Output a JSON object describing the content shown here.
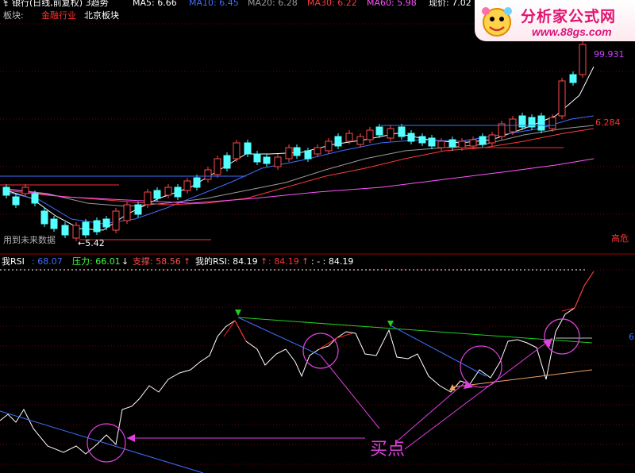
{
  "header": {
    "stock_title": "钅银行(日线,前复权) 3趋势",
    "ma_items": [
      {
        "label": "MA5: 6.66",
        "color": "#ffffff"
      },
      {
        "label": "MA10: 6.45",
        "color": "#3f6fff"
      },
      {
        "label": "MA20: 6.28",
        "color": "#9b9b9b"
      },
      {
        "label": "MA30: 6.22",
        "color": "#ff3b3b"
      },
      {
        "label": "MA60: 5.98",
        "color": "#ff55ff"
      }
    ],
    "current_price": "现价: 7.02",
    "sector_label": "板块:",
    "sectors": [
      {
        "label": "金融行业",
        "color": "#ff3030"
      },
      {
        "label": "北京板块",
        "color": "#ffffff"
      }
    ]
  },
  "logo": {
    "line1": "分析家公式网",
    "line2": "www.88gs.com"
  },
  "price_panel": {
    "high_label": "99.931",
    "mid_label": "6.284",
    "low_label": "←5.42",
    "bottom_left_note": "用到未来数据",
    "right_note": "高危"
  },
  "rsi_header": {
    "name": "我RSI",
    "name_value": ": 68.07",
    "pressure_label": "压力: 66.01",
    "pressure_arrow": "↓",
    "support_label": "支撑: 58.56",
    "support_arrow": "↑",
    "myrsi_label": "我的RSI: 84.19",
    "myrsi_arrow": "↑",
    "val2": ": 84.19",
    "val2_arrow": "↑",
    "val3": ": - : 84.19"
  },
  "rsi_panel": {
    "annotation": "买点",
    "right_edge_label": "6"
  },
  "colors": {
    "up": "#ff4a4a",
    "down": "#54ffff",
    "grid": "#800000",
    "rsi_line": "#ffffff",
    "rsi_up_line": "#ff2020",
    "annotation": "#e040e0"
  },
  "chart_data": [
    {
      "type": "candlestick",
      "title": "",
      "price_axis_labels": [
        "99.931",
        "6.284",
        "←5.42"
      ],
      "note": "candles and moving averages; price scale labels only partially printed",
      "series": [
        {
          "name": "MA5",
          "value_last": 6.66
        },
        {
          "name": "MA10",
          "value_last": 6.45
        },
        {
          "name": "MA20",
          "value_last": 6.28
        },
        {
          "name": "MA30",
          "value_last": 6.22
        },
        {
          "name": "MA60",
          "value_last": 5.98
        }
      ],
      "current_price": 7.02,
      "low_marker": 5.42,
      "high_marker": 99.931,
      "marker_6284": 6.284
    },
    {
      "type": "line",
      "title": "",
      "series": [
        {
          "name": "我RSI",
          "last": 68.07
        },
        {
          "name": "压力",
          "last": 66.01
        },
        {
          "name": "支撑",
          "last": 58.56
        },
        {
          "name": "我的RSI",
          "last": 84.19
        }
      ],
      "annotation": "买点"
    }
  ]
}
